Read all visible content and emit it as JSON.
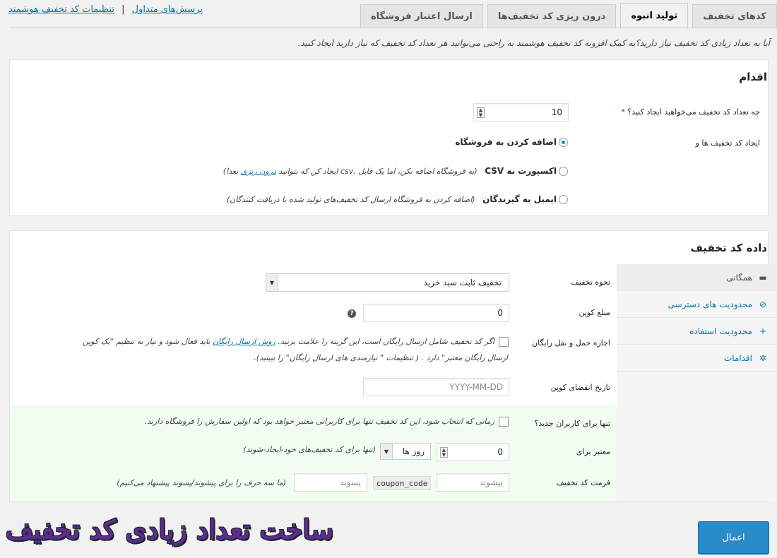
{
  "tabs": [
    {
      "label": "کدهای تخفیف",
      "active": false
    },
    {
      "label": "تولید انبوه",
      "active": true
    },
    {
      "label": "درون ریزی کد تخفیف‌ها",
      "active": false
    },
    {
      "label": "ارسال اعتبار فروشگاه",
      "active": false
    }
  ],
  "top_links": {
    "faq": "پرسش‌های متداول",
    "separator": "|",
    "settings": "تنظیمات کد تخفیف هوشمند"
  },
  "intro": "آیا به تعداد زیادی کد تخفیف نیاز دارید؟به کمک افزونه کد تخفیف هوشمند به راحتی می‌توانید هر تعداد کد تخفیف که نیاز دارید ایجاد کنید.",
  "action_panel": {
    "title": "اقدام",
    "quantity_label": "چه تعداد کد تخفیف می‌خواهید ایجاد کنید؟",
    "required_mark": "*",
    "quantity_value": "10",
    "create_label": "ایجاد کد تخفیف ها و",
    "options": [
      {
        "bold": "اضافه کردن به فروشگاه",
        "note_pre": "",
        "link": "",
        "note_post": "",
        "checked": true
      },
      {
        "bold": "اکسپورت به CSV",
        "note_pre": "(به فروشگاه اضافه نکن، اما یک فایل .csv ایجاد کن که بتوانید ",
        "link": "درون ریزی",
        "note_post": " بعدا)",
        "checked": false
      },
      {
        "bold": "ایمیل به گیرندگان",
        "note_pre": "(اضافه کردن به فروشگاه ارسال کد تخفیف‌های تولید شده با دریافت کنندگان)",
        "link": "",
        "note_post": "",
        "checked": false
      }
    ]
  },
  "coupon_panel": {
    "title": "داده کد تخفیف",
    "side_tabs": [
      {
        "label": "همگانی",
        "icon": "ticket-icon",
        "glyph": "▬",
        "active": true
      },
      {
        "label": "محدودیت های دسترسی",
        "icon": "ban-icon",
        "glyph": "⊘",
        "active": false
      },
      {
        "label": "محدودیت استفاده",
        "icon": "plus-icon",
        "glyph": "+",
        "active": false
      },
      {
        "label": "اقدامات",
        "icon": "gear-icon",
        "glyph": "✲",
        "active": false
      }
    ],
    "discount_type_label": "نحوه تخفیف",
    "discount_type_value": "تخفیف ثابت سبد خرید",
    "amount_label": "مبلغ کوپن",
    "amount_value": "0",
    "help_glyph": "?",
    "free_ship_label": "اجازه حمل و نقل رایگان",
    "free_ship_text_1": "اگر کد تخفیف شامل ارسال رایگان است، این گزینه را علامت بزنید. ",
    "free_ship_link": "روش ارسال رایگان",
    "free_ship_text_2": " باید فعال شود و نیاز به تنظیم \"یک کوپن",
    "free_ship_text_3": "ارسال رایگان معتبر\" دارد . ( تنظیمات \" نیازمندی های ارسال رایگان\" را ببینید).",
    "expiry_label": "تاریخ انقضای کوپن",
    "expiry_placeholder": "YYYY-MM-DD",
    "new_users_label": "تنها برای کاربران جدید؟",
    "new_users_text": "زمانی که انتخاب شود، این کد تخفیف تنها برای کاربرانی معتبر خواهد بود که اولین سفارش را فروشگاه دارند.",
    "valid_for_label": "معتبر برای",
    "valid_for_value": "0",
    "valid_unit": "روز ها",
    "valid_note": "(تنها برای کد تخفیف‌های خود-ایجاد-شوند)",
    "format_label": "فرمت کد تخفیف",
    "prefix_placeholder": "پیشوند",
    "code_tag": "coupon_code",
    "suffix_placeholder": "پسوند",
    "format_note": "(ما سه حرف را برای پیشوند/پسوند پیشنهاد می‌کنیم)"
  },
  "apply_label": "اعمال",
  "caption": "ساخت تعداد زیادی کد تخفیف",
  "colors": {
    "accent": "#0073aa",
    "button": "#2a8bc9",
    "highlight_bg": "#f1fdf0",
    "caption": "#5a2d91"
  }
}
